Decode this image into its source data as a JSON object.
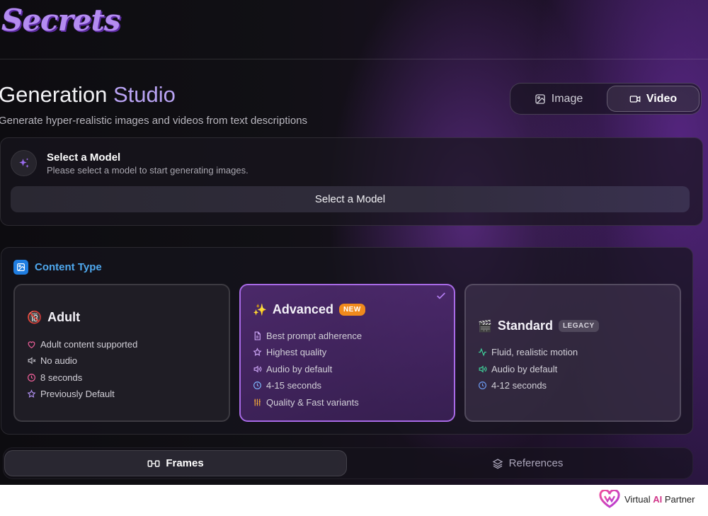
{
  "header": {
    "logo_text": "Secrets"
  },
  "hero": {
    "title_main": "Generation ",
    "title_accent": "Studio",
    "subtitle": "Generate hyper-realistic images and videos from text descriptions"
  },
  "mode_toggle": {
    "options": [
      {
        "label": "Image",
        "icon": "image-icon",
        "selected": false
      },
      {
        "label": "Video",
        "icon": "video-icon",
        "selected": true
      }
    ]
  },
  "model": {
    "icon": "sparkles-icon",
    "title": "Select a Model",
    "description": "Please select a model to start generating images.",
    "button_label": "Select a Model"
  },
  "content_type": {
    "icon": "image-icon",
    "title": "Content Type",
    "options": [
      {
        "name": "Adult",
        "emoji": "🔞",
        "badge": "",
        "selected": false,
        "features": [
          {
            "icon": "heart-icon",
            "text": "Adult content supported"
          },
          {
            "icon": "muted-speaker-icon",
            "text": "No audio"
          },
          {
            "icon": "clock-icon",
            "text": "8 seconds"
          },
          {
            "icon": "star-icon",
            "text": "Previously Default"
          }
        ]
      },
      {
        "name": "Advanced",
        "emoji": "✨",
        "badge": "NEW",
        "selected": true,
        "features": [
          {
            "icon": "document-icon",
            "text": "Best prompt adherence"
          },
          {
            "icon": "star-icon",
            "text": "Highest quality"
          },
          {
            "icon": "speaker-icon",
            "text": "Audio by default"
          },
          {
            "icon": "clock-icon",
            "text": "4-15 seconds"
          },
          {
            "icon": "sliders-icon",
            "text": "Quality & Fast variants"
          }
        ]
      },
      {
        "name": "Standard",
        "emoji": "🎬",
        "badge": "LEGACY",
        "selected": false,
        "features": [
          {
            "icon": "activity-icon",
            "text": "Fluid, realistic motion"
          },
          {
            "icon": "speaker-icon",
            "text": "Audio by default"
          },
          {
            "icon": "clock-icon",
            "text": "4-12 seconds"
          }
        ]
      }
    ]
  },
  "bottom_tabs": [
    {
      "label": "Frames",
      "icon": "frames-icon",
      "selected": true
    },
    {
      "label": "References",
      "icon": "layers-icon",
      "selected": false
    }
  ],
  "watermark": {
    "brand_prefix": "Virtual ",
    "brand_ai": "AI",
    "brand_suffix": " Partner"
  },
  "colors": {
    "accent_purple": "#a86ae6",
    "title_accent": "#b9a3f3",
    "content_type_blue": "#4fa8ee",
    "badge_new": "#f08a1c"
  }
}
